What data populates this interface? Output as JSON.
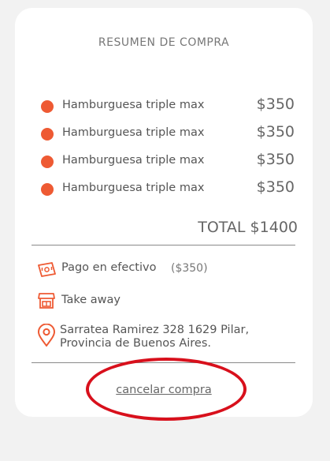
{
  "summary": {
    "title": "RESUMEN DE COMPRA",
    "items": [
      {
        "name": "Hamburguesa triple max",
        "price": "$350"
      },
      {
        "name": "Hamburguesa triple max",
        "price": "$350"
      },
      {
        "name": "Hamburguesa triple max",
        "price": "$350"
      },
      {
        "name": "Hamburguesa triple max",
        "price": "$350"
      }
    ],
    "total": "TOTAL $1400"
  },
  "payment": {
    "icon": "cash-icon",
    "label": "Pago en efectivo",
    "amount": "($350)"
  },
  "delivery": {
    "icon": "store-icon",
    "label": "Take away"
  },
  "address": {
    "icon": "location-pin-icon",
    "line1": "Sarratea Ramirez 328 1629 Pilar,",
    "line2": "Provincia de Buenos Aires."
  },
  "actions": {
    "cancel_label": "cancelar compra"
  },
  "colors": {
    "accent": "#ee5a33",
    "highlight": "#d8101c",
    "card": "#ffffff",
    "background": "#f2f2f2"
  }
}
